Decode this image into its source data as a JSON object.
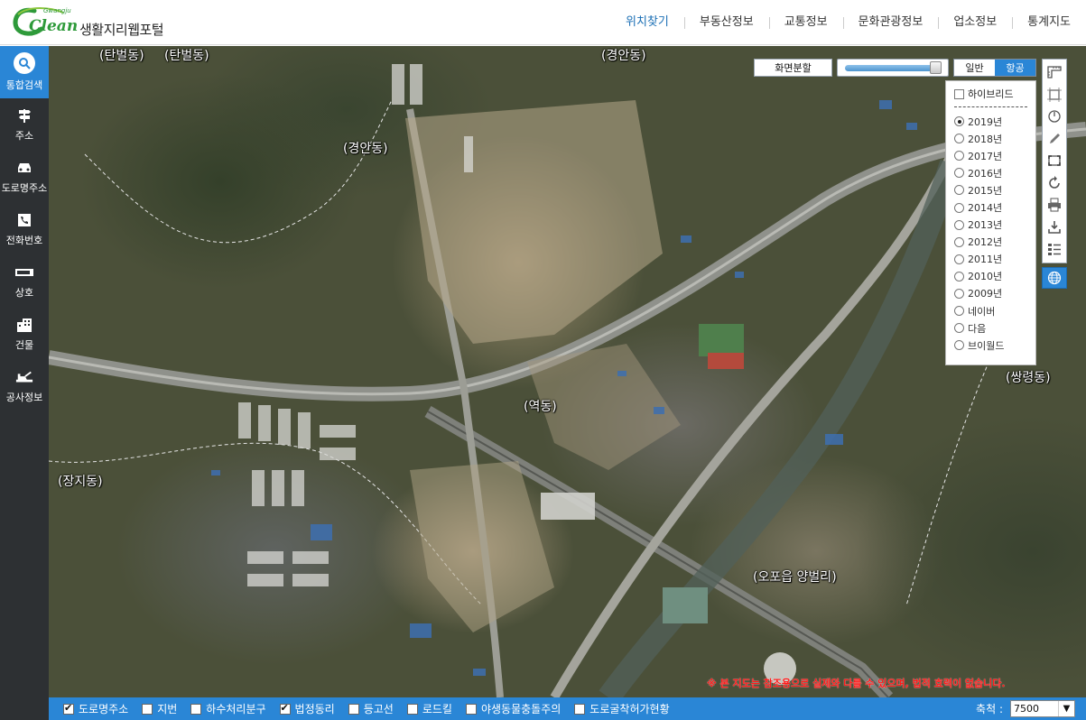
{
  "header": {
    "logo_text": "Clean",
    "logo_subtext": "Gwangju",
    "site_title": "생활지리웹포털",
    "nav": [
      "위치찾기",
      "부동산정보",
      "교통정보",
      "문화관광정보",
      "업소정보",
      "통계지도"
    ],
    "active_nav": "위치찾기"
  },
  "sidebar": {
    "items": [
      {
        "label": "통합검색",
        "icon": "search-icon"
      },
      {
        "label": "주소",
        "icon": "signpost-icon"
      },
      {
        "label": "도로명주소",
        "icon": "car-icon"
      },
      {
        "label": "전화번호",
        "icon": "phone-icon"
      },
      {
        "label": "상호",
        "icon": "sign-icon"
      },
      {
        "label": "건물",
        "icon": "building-icon"
      },
      {
        "label": "공사정보",
        "icon": "construction-icon"
      }
    ],
    "toggle_glyph": "›"
  },
  "map": {
    "places": [
      "(탄벌동)",
      "(탄벌동)",
      "(경안동)",
      "(경안동)",
      "(역동)",
      "(장지동)",
      "(오포읍 양벌리)",
      "(쌍령동)"
    ],
    "split_button": "화면분할",
    "transparency_level": 0.95,
    "basemap": {
      "normal": "일반",
      "aerial": "항공",
      "selected": "항공"
    },
    "hybrid_label": "하이브리드",
    "years": [
      "2019년",
      "2018년",
      "2017년",
      "2016년",
      "2015년",
      "2014년",
      "2013년",
      "2012년",
      "2011년",
      "2010년",
      "2009년",
      "네이버",
      "다음",
      "브이월드"
    ],
    "selected_year": "2019년",
    "tools": [
      "ruler-icon",
      "area-measure-icon",
      "radius-icon",
      "pencil-icon",
      "fullscreen-icon",
      "refresh-icon",
      "print-icon",
      "download-icon",
      "legend-icon"
    ],
    "globe_tool": "globe-icon",
    "notice": "※ 본 지도는 참조용으로 실제와 다를 수 있으며, 법적 효력이 없습니다."
  },
  "bottom": {
    "layers": [
      {
        "label": "도로명주소",
        "checked": true
      },
      {
        "label": "지번",
        "checked": false
      },
      {
        "label": "하수처리분구",
        "checked": false
      },
      {
        "label": "법정동리",
        "checked": true
      },
      {
        "label": "등고선",
        "checked": false
      },
      {
        "label": "로드킬",
        "checked": false
      },
      {
        "label": "야생동물충돌주의",
        "checked": false
      },
      {
        "label": "도로굴착허가현황",
        "checked": false
      }
    ],
    "scale_label": "축척 :",
    "scale_value": "7500"
  },
  "colors": {
    "accent": "#2a86d6",
    "sidebar_bg": "#2d3033",
    "logo_green": "#2e9a3a",
    "notice_red": "#ff1a1a"
  }
}
